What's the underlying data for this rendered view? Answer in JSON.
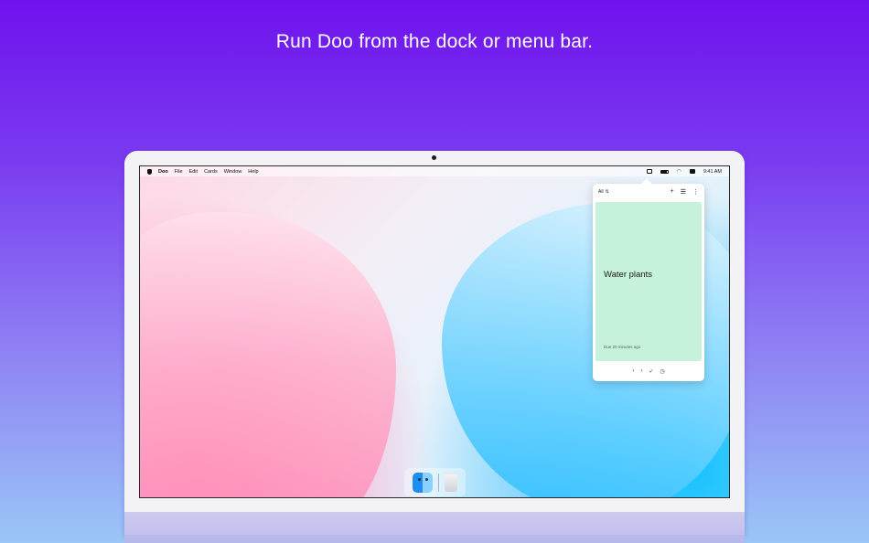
{
  "headline": "Run Doo from the dock or menu bar.",
  "menubar": {
    "apple_icon": "apple-icon",
    "app_name": "Doo",
    "items": [
      "File",
      "Edit",
      "Cards",
      "Window",
      "Help"
    ],
    "status_icons": [
      "doo-menu-icon",
      "battery-icon",
      "wifi-icon",
      "control-center-icon"
    ],
    "time": "9:41 AM"
  },
  "popover": {
    "filter": "All",
    "filter_icon": "up-down-chevron-icon",
    "header_actions": [
      "plus-icon",
      "list-icon",
      "more-icon"
    ],
    "card": {
      "title": "Water plants",
      "due": "Due 20 minutes ago",
      "color": "#c6f2dc"
    },
    "footer_actions": [
      "chevron-left-icon",
      "chevron-right-icon",
      "checkmark-icon",
      "snooze-icon"
    ]
  },
  "dock": {
    "apps": [
      "finder-icon",
      "trash-icon"
    ]
  }
}
